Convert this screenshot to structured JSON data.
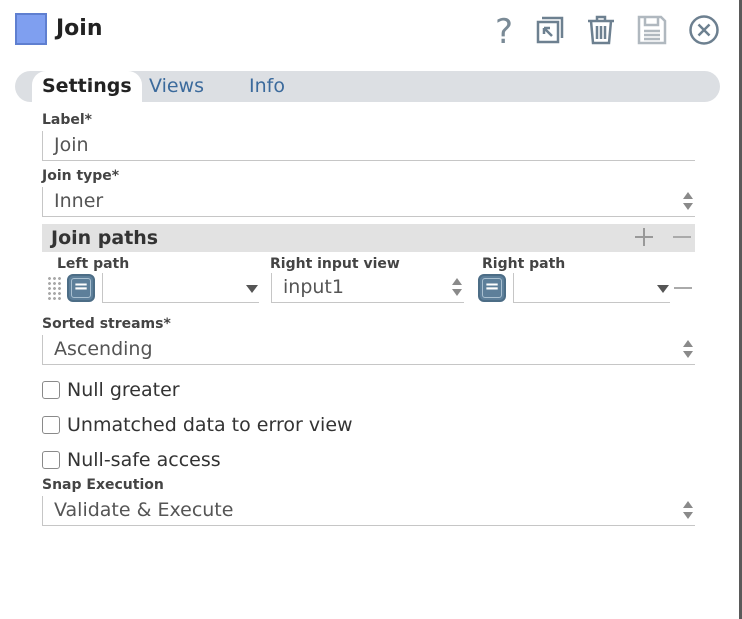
{
  "header": {
    "title": "Join",
    "swatch_color": "#7f9ff0",
    "icons": [
      "help-icon",
      "expand-icon",
      "trash-icon",
      "save-icon",
      "close-icon"
    ]
  },
  "tabs": [
    {
      "label": "Settings",
      "active": true
    },
    {
      "label": "Views",
      "active": false
    },
    {
      "label": "Info",
      "active": false
    }
  ],
  "form": {
    "label": {
      "label": "Label*",
      "value": "Join"
    },
    "join_type": {
      "label": "Join type*",
      "value": "Inner"
    },
    "join_paths": {
      "title": "Join paths",
      "left_path_label": "Left path",
      "right_input_view_label": "Right input view",
      "right_path_label": "Right path",
      "equals_symbol": "=",
      "left_path_value": "",
      "right_input_view_value": "input1",
      "right_path_value": ""
    },
    "sorted_streams": {
      "label": "Sorted streams*",
      "value": "Ascending"
    },
    "checkboxes": [
      {
        "label": "Null greater",
        "checked": false
      },
      {
        "label": "Unmatched data to error view",
        "checked": false
      },
      {
        "label": "Null-safe access",
        "checked": false
      }
    ],
    "snap_execution": {
      "label": "Snap Execution",
      "value": "Validate & Execute"
    }
  },
  "colors": {
    "accent": "#3b6a9c",
    "button": "#5d7f9a",
    "section_bg": "#e2e2e2"
  }
}
